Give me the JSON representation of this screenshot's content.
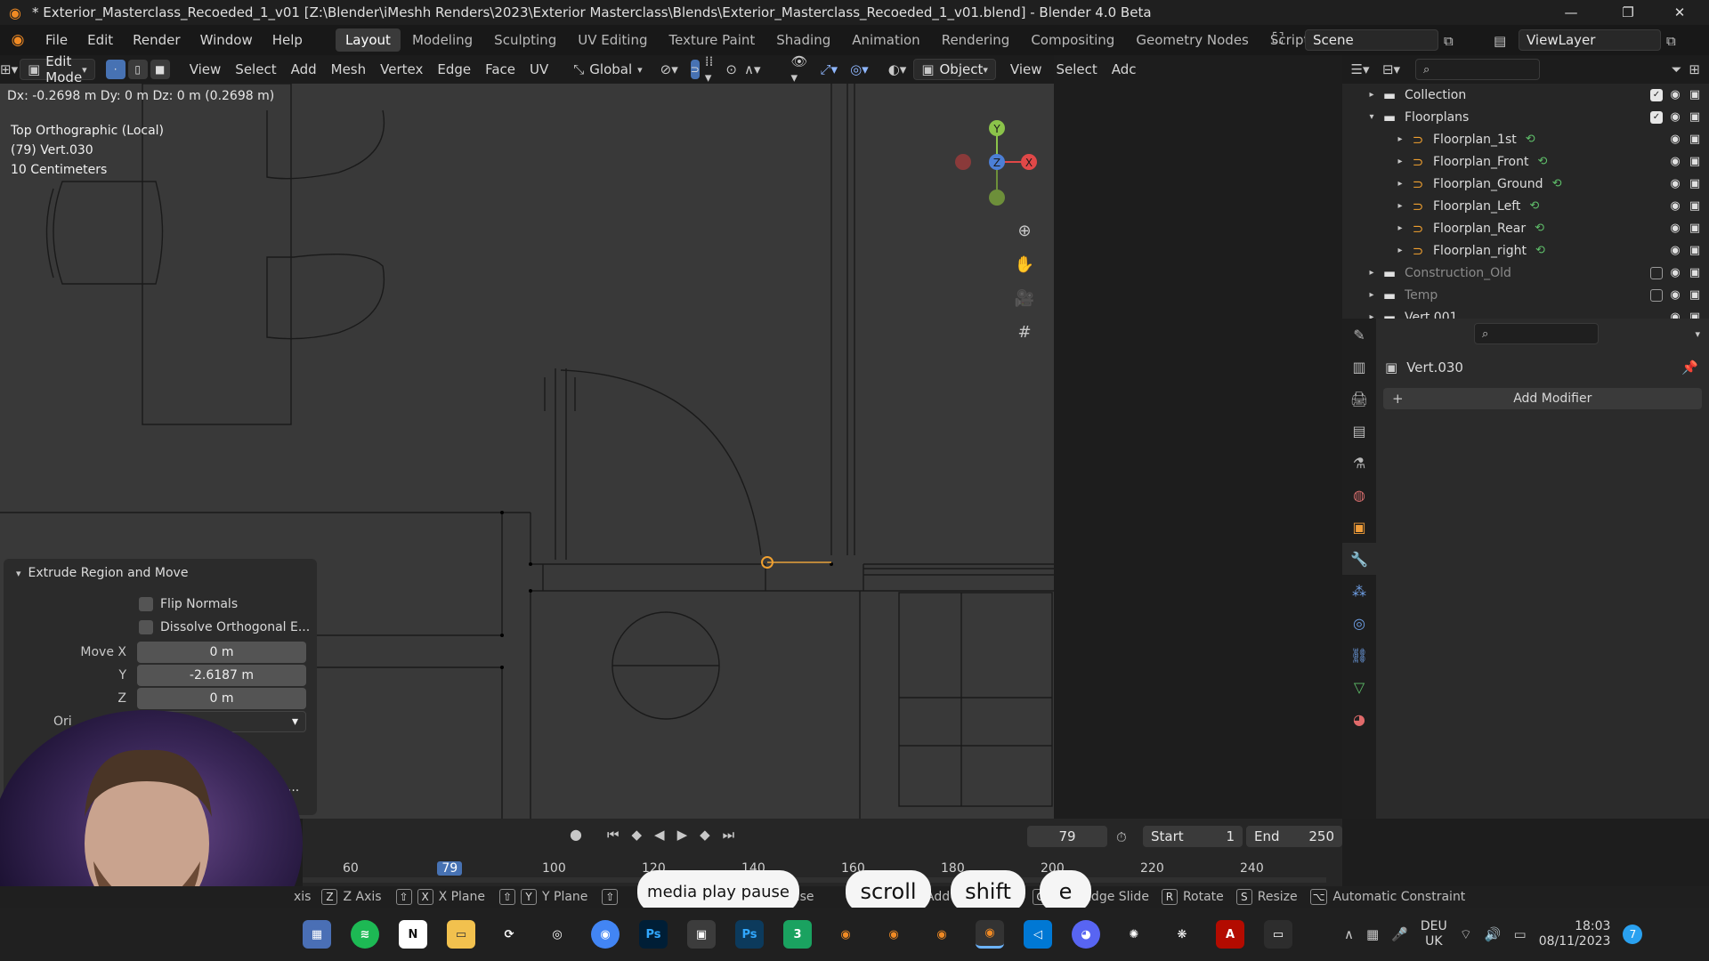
{
  "window": {
    "title": "* Exterior_Masterclass_Recoeded_1_v01 [Z:\\Blender\\iMeshh Renders\\2023\\Exterior Masterclass\\Blends\\Exterior_Masterclass_Recoeded_1_v01.blend] - Blender 4.0 Beta"
  },
  "menu": [
    "File",
    "Edit",
    "Render",
    "Window",
    "Help"
  ],
  "workspaces": [
    "Layout",
    "Modeling",
    "Sculpting",
    "UV Editing",
    "Texture Paint",
    "Shading",
    "Animation",
    "Rendering",
    "Compositing",
    "Geometry Nodes",
    "Scripting"
  ],
  "scene": {
    "name": "Scene",
    "view_layer": "ViewLayer"
  },
  "viewport_header": {
    "mode": "Edit Mode",
    "menus": [
      "View",
      "Select",
      "Add",
      "Mesh",
      "Vertex",
      "Edge",
      "Face",
      "UV"
    ],
    "orientation": "Global",
    "object_mode": "Object",
    "right_menus": [
      "View",
      "Select",
      "Adc"
    ]
  },
  "viewport": {
    "status": "Dx: -0.2698 m   Dy: 0 m   Dz: 0 m (0.2698 m)",
    "view_name": "Top Orthographic (Local)",
    "object_info": "(79) Vert.030",
    "scale": "10 Centimeters",
    "gizmo": {
      "y": "Y",
      "z": "Z",
      "x": "X"
    }
  },
  "operator_panel": {
    "title": "Extrude Region and Move",
    "flip_normals": "Flip Normals",
    "dissolve": "Dissolve Orthogonal E...",
    "move_label": "Move X",
    "move_x": "0 m",
    "y_label": "Y",
    "move_y": "-2.6187 m",
    "z_label": "Z",
    "move_z": "0 m",
    "ori_label": "Ori",
    "extra": "n..."
  },
  "outliner": {
    "rows": [
      {
        "label": "Collection",
        "indent": 0,
        "checked": true
      },
      {
        "label": "Floorplans",
        "indent": 0,
        "checked": true
      },
      {
        "label": "Floorplan_1st",
        "indent": 1
      },
      {
        "label": "Floorplan_Front",
        "indent": 1
      },
      {
        "label": "Floorplan_Ground",
        "indent": 1
      },
      {
        "label": "Floorplan_Left",
        "indent": 1
      },
      {
        "label": "Floorplan_Rear",
        "indent": 1
      },
      {
        "label": "Floorplan_right",
        "indent": 1
      },
      {
        "label": "Construction_Old",
        "indent": 0,
        "checked": false
      },
      {
        "label": "Temp",
        "indent": 0,
        "checked": false
      },
      {
        "label": "Vert.001",
        "indent": 0
      }
    ]
  },
  "properties": {
    "object": "Vert.030",
    "add_modifier": "Add Modifier"
  },
  "timeline": {
    "current_frame": "79",
    "start_label": "Start",
    "start": "1",
    "end_label": "End",
    "end": "250",
    "ticks": [
      "60",
      "79",
      "100",
      "120",
      "140",
      "160",
      "180",
      "200",
      "220",
      "240"
    ]
  },
  "statusbar": {
    "items": [
      "xis",
      "Z Axis",
      "X Plane",
      "Y Plane",
      "Base",
      "t",
      "Add Snap Point",
      "Vert/Edge Slide",
      "Rotate",
      "Resize",
      "Automatic Constraint"
    ],
    "keys": [
      "Z",
      "X",
      "Y",
      "G",
      "R",
      "S"
    ]
  },
  "keypresses": [
    "media play pause",
    "scroll",
    "shift",
    "e"
  ],
  "taskbar": {
    "lang": "DEU",
    "region": "UK",
    "time": "18:03",
    "date": "08/11/2023",
    "badge": "7"
  }
}
